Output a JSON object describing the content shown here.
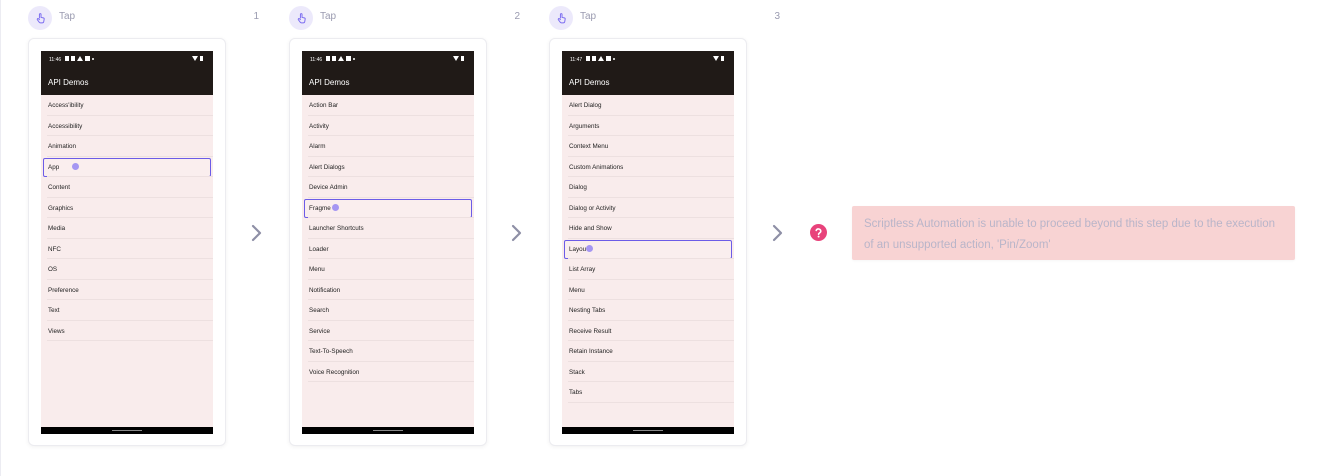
{
  "steps": [
    {
      "action": "Tap",
      "number": "1",
      "app_title": "API Demos",
      "time": "11:46",
      "items": [
        "Access'ibility",
        "Accessibility",
        "Animation",
        "App",
        "Content",
        "Graphics",
        "Media",
        "NFC",
        "OS",
        "Preference",
        "Text",
        "Views"
      ],
      "highlighted_item": "App"
    },
    {
      "action": "Tap",
      "number": "2",
      "app_title": "API Demos",
      "time": "11:46",
      "items": [
        "Action Bar",
        "Activity",
        "Alarm",
        "Alert Dialogs",
        "Device Admin",
        "Fragme",
        "Launcher Shortcuts",
        "Loader",
        "Menu",
        "Notification",
        "Search",
        "Service",
        "Text-To-Speech",
        "Voice Recognition"
      ],
      "highlighted_item": "Fragme"
    },
    {
      "action": "Tap",
      "number": "3",
      "app_title": "API Demos",
      "time": "11:47",
      "items": [
        "Alert Dialog",
        "Arguments",
        "Context Menu",
        "Custom Animations",
        "Dialog",
        "Dialog or Activity",
        "Hide and Show",
        "Layou",
        "List Array",
        "Menu",
        "Nesting Tabs",
        "Receive Result",
        "Retain Instance",
        "Stack",
        "Tabs"
      ],
      "highlighted_item": "Layou"
    }
  ],
  "error": {
    "icon": "question-circle-icon",
    "message": "Scriptless Automation is unable to proceed beyond this step due to the execution of an unsupported action, 'Pin/Zoom'"
  },
  "colors": {
    "accent": "#6c5ce7",
    "error_bg": "#f8d3d3",
    "error_icon": "#e8437b",
    "appbar": "#201a17",
    "list_bg": "#f9ecec"
  }
}
